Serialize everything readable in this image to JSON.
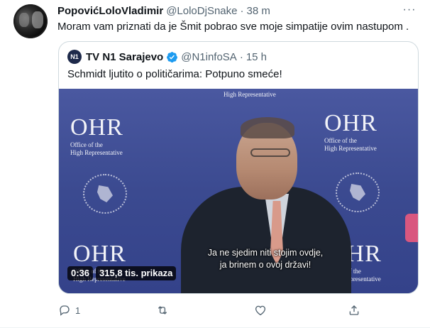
{
  "tweet": {
    "author_name": "PopovićLoloVladimir",
    "author_handle": "@LoloDjSnake",
    "separator": "·",
    "time": "38 m",
    "more_label": "···",
    "text": "Moram vam priznati da je Šmit pobrao sve moje simpatije ovim nastupom ."
  },
  "quote": {
    "avatar_text": "N1",
    "author_name": "TV N1 Sarajevo",
    "author_handle": "@N1infoSA",
    "separator": "·",
    "time": "15 h",
    "text": "Schmidt ljutito o političarima: Potpuno smeće!"
  },
  "video": {
    "logo_big": "OHR",
    "logo_line1": "Office of the",
    "logo_line2": "High Representative",
    "top_caption": "High Representative",
    "subtitle_line1": "Ja ne sjedim niti stojim ovdje,",
    "subtitle_line2": "ja brinem o ovoj državi!",
    "duration": "0:36",
    "views": "315,8 tis. prikaza"
  },
  "actions": {
    "reply_count": "1",
    "retweet_count": "",
    "like_count": "",
    "share_count": ""
  },
  "colors": {
    "text_primary": "#0f1419",
    "text_secondary": "#536471",
    "verified_blue": "#1d9bf0",
    "video_bg": "#3e4c8e",
    "border": "#cfd9de"
  },
  "icons": [
    "reply-icon",
    "retweet-icon",
    "like-icon",
    "share-icon",
    "verified-icon",
    "more-icon"
  ]
}
